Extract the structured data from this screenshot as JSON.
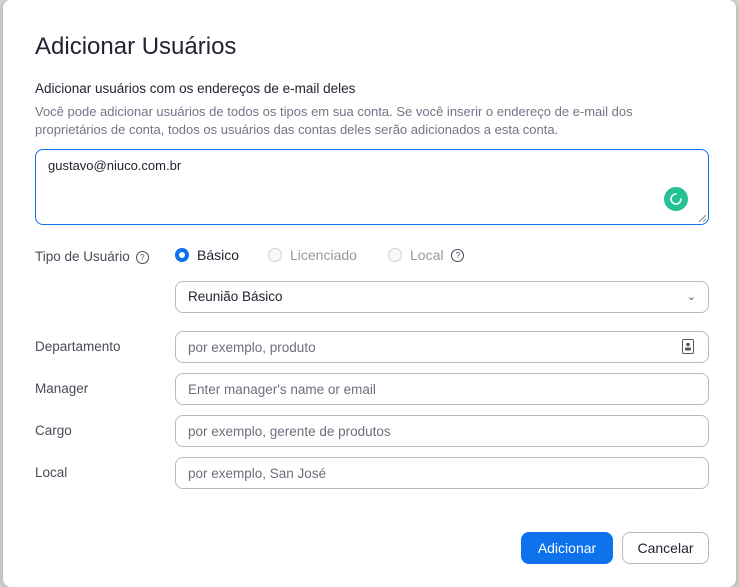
{
  "dialog": {
    "title": "Adicionar Usuários",
    "subtitle": "Adicionar usuários com os endereços de e-mail deles",
    "description": "Você pode adicionar usuários de todos os tipos em sua conta. Se você inserir o endereço de e-mail dos proprietários de conta, todos os usuários das contas deles serão adicionados a esta conta.",
    "email_value": "gustavo@niuco.com.br"
  },
  "user_type": {
    "label": "Tipo de Usuário",
    "options": [
      {
        "label": "Básico",
        "selected": true,
        "enabled": true
      },
      {
        "label": "Licenciado",
        "selected": false,
        "enabled": false
      },
      {
        "label": "Local",
        "selected": false,
        "enabled": false
      }
    ],
    "meeting_select": "Reunião Básico"
  },
  "fields": {
    "department": {
      "label": "Departamento",
      "placeholder": "por exemplo, produto"
    },
    "manager": {
      "label": "Manager",
      "placeholder": "Enter manager's name or email"
    },
    "job_title": {
      "label": "Cargo",
      "placeholder": "por exemplo, gerente de produtos"
    },
    "location": {
      "label": "Local",
      "placeholder": "por exemplo, San José"
    }
  },
  "buttons": {
    "add": "Adicionar",
    "cancel": "Cancelar"
  },
  "colors": {
    "accent": "#0e72ed",
    "spinner": "#25c194"
  }
}
